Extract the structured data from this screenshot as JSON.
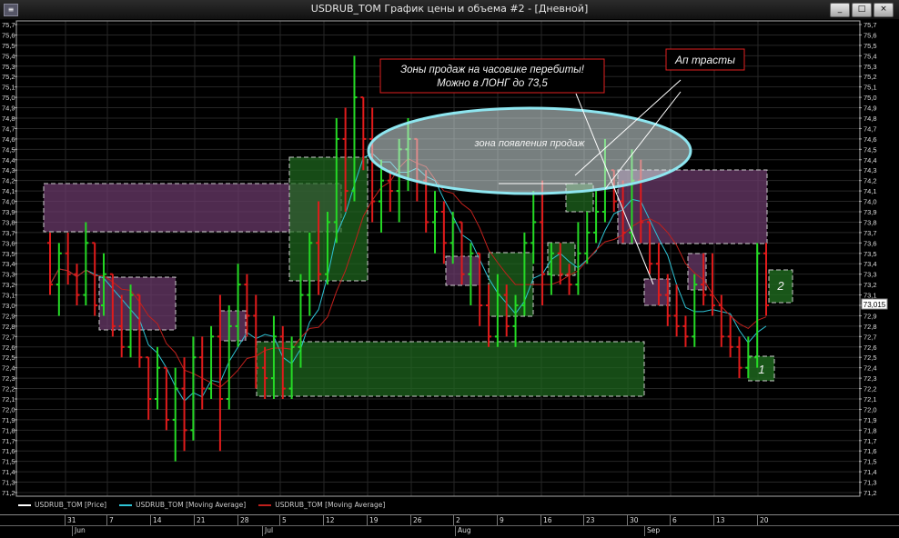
{
  "window": {
    "title": "USDRUB_TOM График цены и объема #2 - [Дневной]",
    "buttons": [
      "_",
      "□",
      "×"
    ]
  },
  "annotations": {
    "sales_zones_line1": "Зоны продаж на часовике перебиты!",
    "sales_zones_line2": "Можно в ЛОНГ до 73,5",
    "uptrust": "Ап трасты",
    "sales_zone": "зона появления продаж",
    "box1": "1",
    "box2": "2"
  },
  "price_label": "73,015",
  "legend": [
    {
      "label": "USDRUB_TOM [Price]",
      "color": "#ffffff"
    },
    {
      "label": "USDRUB_TOM [Moving Average]",
      "color": "#2ec4d6"
    },
    {
      "label": "USDRUB_TOM [Moving Average]",
      "color": "#c0201c"
    }
  ],
  "x_axis": {
    "days": [
      "31",
      "7",
      "14",
      "21",
      "28",
      "5",
      "12",
      "19",
      "26",
      "2",
      "9",
      "16",
      "23",
      "30",
      "6",
      "13",
      "20"
    ],
    "months": [
      "Jun",
      "Jul",
      "Aug",
      "Sep"
    ]
  },
  "chart_data": {
    "type": "bar",
    "title": "USDRUB_TOM",
    "ylim": [
      71.2,
      75.7
    ],
    "y_ticks": [
      "75,7",
      "75,6",
      "75,5",
      "75,4",
      "75,3",
      "75,2",
      "75,1",
      "75,0",
      "74,9",
      "74,8",
      "74,7",
      "74,6",
      "74,5",
      "74,4",
      "74,3",
      "74,2",
      "74,1",
      "74,0",
      "73,9",
      "73,8",
      "73,7",
      "73,6",
      "73,5",
      "73,4",
      "73,3",
      "73,2",
      "73,1",
      "73,0",
      "72,9",
      "72,8",
      "72,7",
      "72,6",
      "72,5",
      "72,4",
      "72,3",
      "72,2",
      "72,1",
      "72,0",
      "71,9",
      "71,8",
      "71,7",
      "71,6",
      "71,5",
      "71,4",
      "71,3",
      "71,2"
    ],
    "grid": true,
    "colors": {
      "up": "#25d925",
      "down": "#e01b1b",
      "ma_fast": "#2ec4d6",
      "ma_slow": "#c0201c"
    },
    "ohlc": [
      [
        73.6,
        73.7,
        73.1,
        73.2
      ],
      [
        73.2,
        73.6,
        72.9,
        73.5
      ],
      [
        73.5,
        73.7,
        73.2,
        73.3
      ],
      [
        73.3,
        73.4,
        73.0,
        73.1
      ],
      [
        73.1,
        73.8,
        73.0,
        73.6
      ],
      [
        73.6,
        73.6,
        72.9,
        73.0
      ],
      [
        73.0,
        73.5,
        72.9,
        73.3
      ],
      [
        73.3,
        73.3,
        72.7,
        72.8
      ],
      [
        72.8,
        73.1,
        72.5,
        72.6
      ],
      [
        72.6,
        73.2,
        72.5,
        73.1
      ],
      [
        73.1,
        73.1,
        72.4,
        72.5
      ],
      [
        72.5,
        72.5,
        71.9,
        72.1
      ],
      [
        72.1,
        72.6,
        72.0,
        72.4
      ],
      [
        72.4,
        72.4,
        71.8,
        71.9
      ],
      [
        71.9,
        72.4,
        71.5,
        72.2
      ],
      [
        72.2,
        72.5,
        71.6,
        71.8
      ],
      [
        71.8,
        72.7,
        71.7,
        72.5
      ],
      [
        72.5,
        72.7,
        72.0,
        72.2
      ],
      [
        72.2,
        72.8,
        72.1,
        72.7
      ],
      [
        72.7,
        73.1,
        71.6,
        72.1
      ],
      [
        72.1,
        73.0,
        72.0,
        72.8
      ],
      [
        72.8,
        73.4,
        72.6,
        73.2
      ],
      [
        73.2,
        73.3,
        72.7,
        72.9
      ],
      [
        72.9,
        73.1,
        72.2,
        72.4
      ],
      [
        72.4,
        72.6,
        72.1,
        72.3
      ],
      [
        72.3,
        72.9,
        72.1,
        72.7
      ],
      [
        72.7,
        72.8,
        72.1,
        72.2
      ],
      [
        72.2,
        72.7,
        72.1,
        72.6
      ],
      [
        72.6,
        73.3,
        72.4,
        73.1
      ],
      [
        73.1,
        73.7,
        72.9,
        73.6
      ],
      [
        73.6,
        74.0,
        73.1,
        73.3
      ],
      [
        73.3,
        73.9,
        73.2,
        73.8
      ],
      [
        73.8,
        74.8,
        73.6,
        74.6
      ],
      [
        74.6,
        74.9,
        73.9,
        74.1
      ],
      [
        74.1,
        75.4,
        74.0,
        75.0
      ],
      [
        75.0,
        75.0,
        74.3,
        74.6
      ],
      [
        74.6,
        74.9,
        73.8,
        74.0
      ],
      [
        74.0,
        74.4,
        73.7,
        74.2
      ],
      [
        74.2,
        74.3,
        73.9,
        74.1
      ],
      [
        74.1,
        74.6,
        73.8,
        74.5
      ],
      [
        74.5,
        74.8,
        74.1,
        74.6
      ],
      [
        74.6,
        74.6,
        74.0,
        74.2
      ],
      [
        74.2,
        74.3,
        73.7,
        73.8
      ],
      [
        73.8,
        74.1,
        73.5,
        73.9
      ],
      [
        73.9,
        74.0,
        73.4,
        73.6
      ],
      [
        73.6,
        73.9,
        73.4,
        73.8
      ],
      [
        73.8,
        73.8,
        73.2,
        73.3
      ],
      [
        73.3,
        73.6,
        73.0,
        73.5
      ],
      [
        73.5,
        73.5,
        72.8,
        73.0
      ],
      [
        73.0,
        73.2,
        72.6,
        72.7
      ],
      [
        72.7,
        73.3,
        72.6,
        73.1
      ],
      [
        73.1,
        73.2,
        72.7,
        72.8
      ],
      [
        72.8,
        73.1,
        72.6,
        73.0
      ],
      [
        73.0,
        73.7,
        72.9,
        73.6
      ],
      [
        73.6,
        74.1,
        73.4,
        73.8
      ],
      [
        73.8,
        74.2,
        73.0,
        73.3
      ],
      [
        73.3,
        73.6,
        73.1,
        73.5
      ],
      [
        73.5,
        73.6,
        73.2,
        73.3
      ],
      [
        73.3,
        73.4,
        73.1,
        73.2
      ],
      [
        73.2,
        73.8,
        73.1,
        73.5
      ],
      [
        73.5,
        73.9,
        73.4,
        73.7
      ],
      [
        73.7,
        74.1,
        73.6,
        73.9
      ],
      [
        73.9,
        74.6,
        73.8,
        74.3
      ],
      [
        74.3,
        74.3,
        73.9,
        74.0
      ],
      [
        74.0,
        74.2,
        73.6,
        73.7
      ],
      [
        73.7,
        74.5,
        73.6,
        74.2
      ],
      [
        74.2,
        74.4,
        73.6,
        73.8
      ],
      [
        73.8,
        73.8,
        73.3,
        73.4
      ],
      [
        73.4,
        73.6,
        73.0,
        73.1
      ],
      [
        73.1,
        73.3,
        72.8,
        72.9
      ],
      [
        72.9,
        73.2,
        72.7,
        72.8
      ],
      [
        72.8,
        72.9,
        72.6,
        72.7
      ],
      [
        72.7,
        73.3,
        72.6,
        73.2
      ],
      [
        73.2,
        73.5,
        73.0,
        73.1
      ],
      [
        73.1,
        73.5,
        72.9,
        73.0
      ],
      [
        73.0,
        73.1,
        72.6,
        72.7
      ],
      [
        72.7,
        72.9,
        72.5,
        72.6
      ],
      [
        72.6,
        72.7,
        72.3,
        72.4
      ],
      [
        72.4,
        72.7,
        72.3,
        72.5
      ],
      [
        72.5,
        73.6,
        72.4,
        73.5
      ],
      [
        73.5,
        73.6,
        72.9,
        73.0
      ]
    ]
  }
}
